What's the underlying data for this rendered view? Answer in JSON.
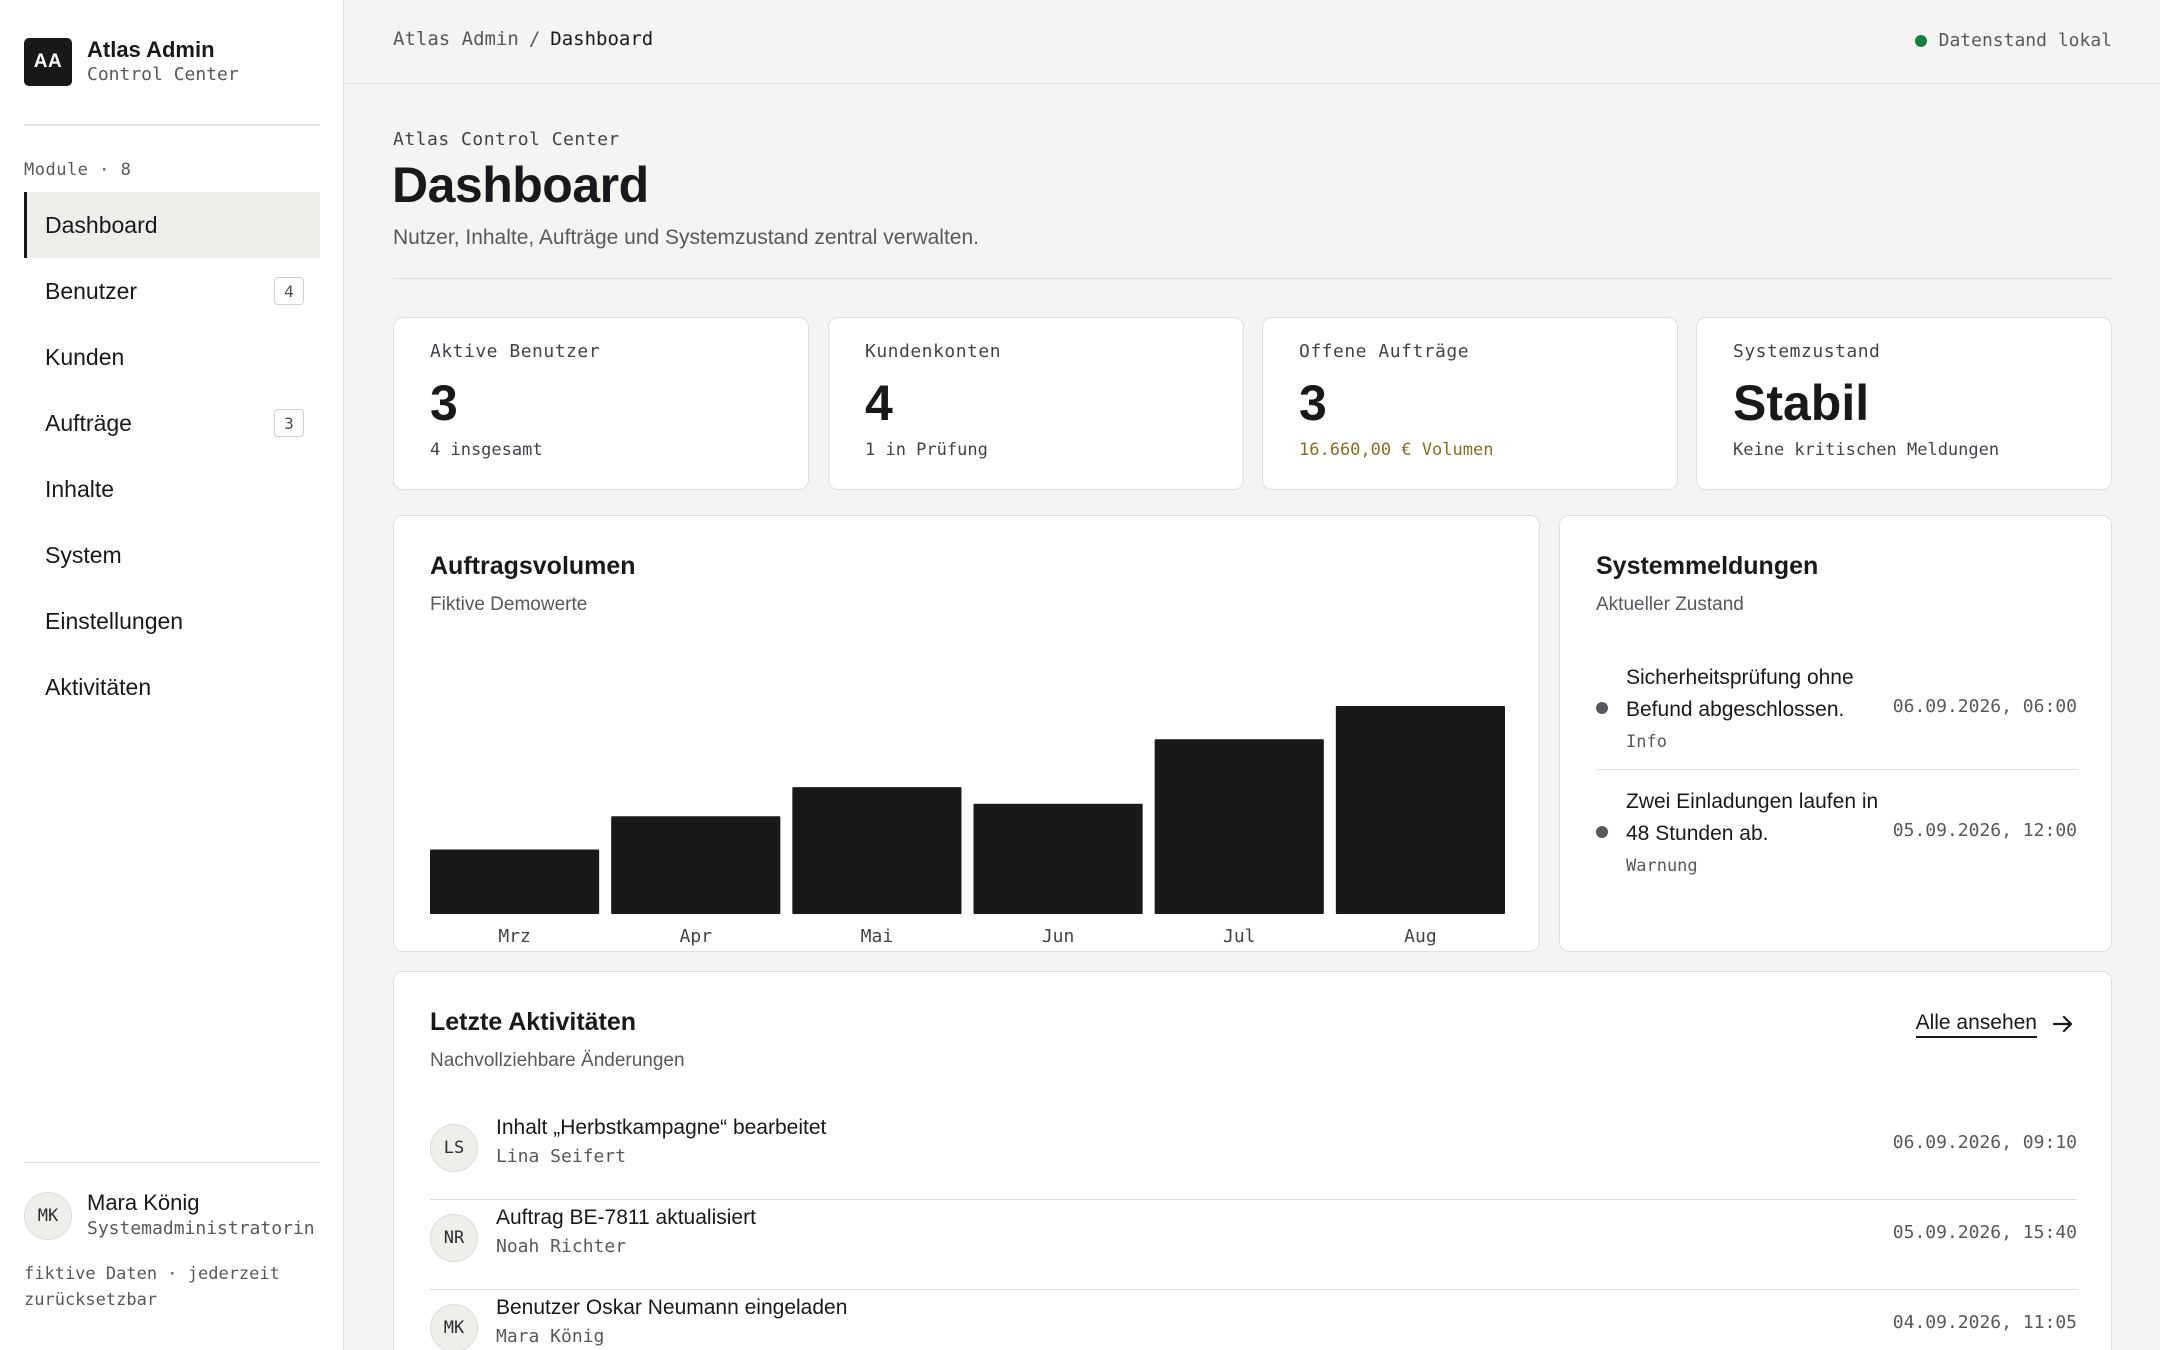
{
  "brand": {
    "logo": "AA",
    "title": "Atlas Admin",
    "subtitle": "Control Center"
  },
  "sidebar": {
    "modules_label": "Module · 8",
    "items": [
      {
        "label": "Dashboard",
        "badge": "",
        "active": true
      },
      {
        "label": "Benutzer",
        "badge": "4"
      },
      {
        "label": "Kunden",
        "badge": ""
      },
      {
        "label": "Aufträge",
        "badge": "3"
      },
      {
        "label": "Inhalte",
        "badge": ""
      },
      {
        "label": "System",
        "badge": ""
      },
      {
        "label": "Einstellungen",
        "badge": ""
      },
      {
        "label": "Aktivitäten",
        "badge": ""
      }
    ],
    "user": {
      "initials": "MK",
      "name": "Mara König",
      "role": "Systemadministratorin"
    },
    "footnote": "fiktive Daten · jederzeit zurücksetzbar"
  },
  "topbar": {
    "breadcrumb_root": "Atlas Admin",
    "breadcrumb_sep": "/",
    "breadcrumb_current": "Dashboard",
    "status": "Datenstand lokal",
    "status_color": "#14803d"
  },
  "header": {
    "eyebrow": "Atlas Control Center",
    "title": "Dashboard",
    "description": "Nutzer, Inhalte, Aufträge und Systemzustand zentral verwalten."
  },
  "kpis": [
    {
      "label": "Aktive Benutzer",
      "value": "3",
      "note": "4 insgesamt"
    },
    {
      "label": "Kundenkonten",
      "value": "4",
      "note": "1 in Prüfung"
    },
    {
      "label": "Offene Aufträge",
      "value": "3",
      "note": "16.660,00 € Volumen"
    },
    {
      "label": "Systemzustand",
      "value": "Stabil",
      "note": "Keine kritischen Meldungen"
    }
  ],
  "chart_card": {
    "title": "Auftragsvolumen",
    "subtitle": "Fiktive Demowerte"
  },
  "chart_data": {
    "type": "bar",
    "categories": [
      "Mrz",
      "Apr",
      "Mai",
      "Jun",
      "Jul",
      "Aug"
    ],
    "values": [
      31,
      47,
      61,
      53,
      84,
      100
    ],
    "ylim": [
      0,
      100
    ],
    "grid": false,
    "bar_color": "#17191b"
  },
  "messages_card": {
    "title": "Systemmeldungen",
    "subtitle": "Aktueller Zustand",
    "items": [
      {
        "text": "Sicherheitsprüfung ohne Befund abgeschlossen.",
        "level": "Info",
        "time": "06.09.2026, 06:00"
      },
      {
        "text": "Zwei Einladungen laufen in 48 Stunden ab.",
        "level": "Warnung",
        "time": "05.09.2026, 12:00"
      }
    ]
  },
  "activities_card": {
    "title": "Letzte Aktivitäten",
    "subtitle": "Nachvollziehbare Änderungen",
    "see_all": "Alle ansehen",
    "items": [
      {
        "initials": "LS",
        "title": "Inhalt „Herbstkampagne“ bearbeitet",
        "user": "Lina Seifert",
        "time": "06.09.2026, 09:10"
      },
      {
        "initials": "NR",
        "title": "Auftrag BE-7811 aktualisiert",
        "user": "Noah Richter",
        "time": "05.09.2026, 15:40"
      },
      {
        "initials": "MK",
        "title": "Benutzer Oskar Neumann eingeladen",
        "user": "Mara König",
        "time": "04.09.2026, 11:05"
      }
    ]
  }
}
